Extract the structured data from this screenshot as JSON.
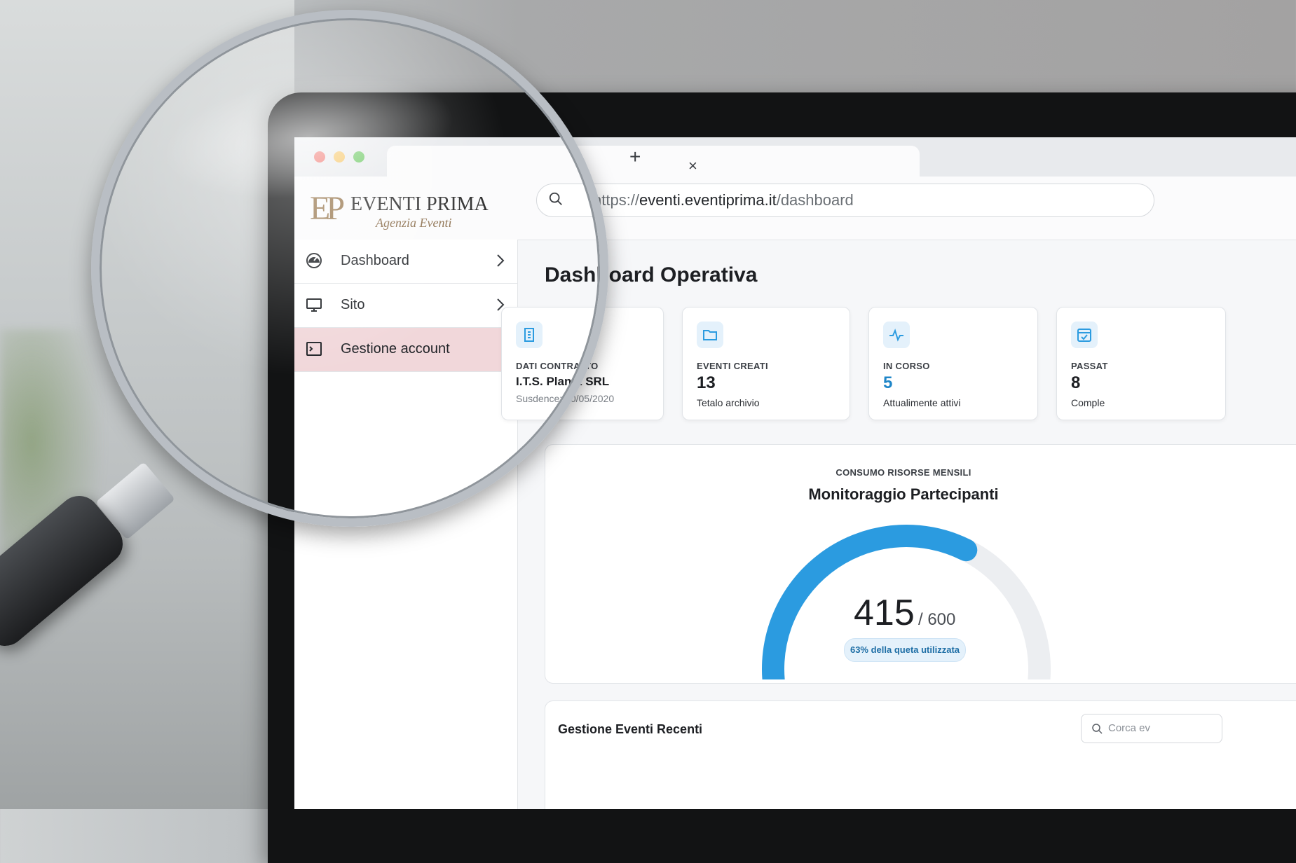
{
  "browser": {
    "tab_close": "×",
    "new_tab": "+",
    "url_prefix": "https://",
    "url_host": "eventi.eventiprima.it",
    "url_path": "/dashboard"
  },
  "brand": {
    "monogram": "EP",
    "title": "EVENTI PRIMA",
    "subtitle": "Agenzia Eventi",
    "color": "#9a7a52"
  },
  "sidebar": {
    "items": [
      {
        "label": "Dashboard",
        "icon": "gauge-icon"
      },
      {
        "label": "Sito",
        "icon": "monitor-icon"
      },
      {
        "label": "Gestione account",
        "icon": "terminal-icon",
        "active": true
      }
    ]
  },
  "main": {
    "title": "Dashboard Operativa",
    "cards": [
      {
        "label": "DATI CONTRATTO",
        "value": "I.T.S. Planet SRL",
        "sub": "Susdence: 20/05/2020",
        "icon": "building-icon"
      },
      {
        "label": "EVENTI CREATI",
        "value": "13",
        "sub": "Tetalo archivio",
        "icon": "folder-icon"
      },
      {
        "label": "IN CORSO",
        "value": "5",
        "sub": "Attualimente attivi",
        "icon": "activity-icon",
        "value_color": "#1f86c8"
      },
      {
        "label": "PASSAT",
        "value": "8",
        "sub": "Comple",
        "icon": "calendar-check-icon"
      }
    ],
    "gauge": {
      "kicker": "CONSUMO RISORSE MENSILI",
      "title": "Monitoraggio Partecipanti",
      "value": "415",
      "max": "/ 600",
      "fraction": 0.63,
      "pill": "63% della queta utilizzata",
      "accent": "#2b9be0"
    },
    "recent": {
      "title": "Gestione Eventi Recenti",
      "search_placeholder": "Corca ev"
    }
  }
}
